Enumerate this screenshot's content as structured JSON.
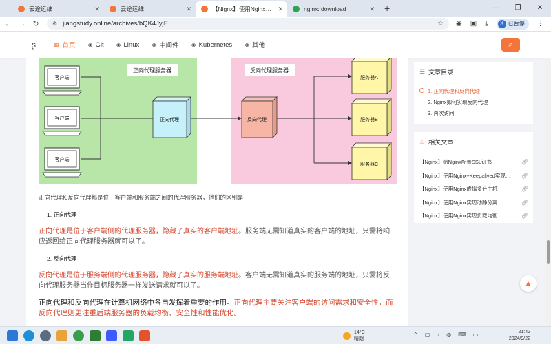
{
  "browser": {
    "tabs": [
      {
        "label": "云途运维",
        "active": false,
        "favicon_color": "#f3753c"
      },
      {
        "label": "云途运维",
        "active": false,
        "favicon_color": "#f3753c"
      },
      {
        "label": "【Nignx】使用Nginx实现反向代理",
        "active": true,
        "favicon_color": "#f3753c"
      },
      {
        "label": "nginx: download",
        "active": false,
        "favicon_color": "#2aa353"
      }
    ],
    "url": "jiangstudy.online/archives/bQK4JyjE",
    "sync_label": "已暂停",
    "avatar_letter": "X"
  },
  "site": {
    "menu": [
      {
        "label": "首页",
        "active": true
      },
      {
        "label": "Git",
        "active": false
      },
      {
        "label": "Linux",
        "active": false
      },
      {
        "label": "中间件",
        "active": false
      },
      {
        "label": "Kubernetes",
        "active": false
      },
      {
        "label": "其他",
        "active": false
      }
    ]
  },
  "diagram": {
    "forward_title": "正向代理服务器",
    "reverse_title": "反向代理服务器",
    "clients": [
      "客户端",
      "客户端",
      "客户端"
    ],
    "forward_proxy": "正向代理",
    "reverse_proxy": "反向代理",
    "servers": [
      "服务器A",
      "服务器B",
      "服务器C"
    ]
  },
  "article": {
    "intro": "正向代理和反向代理都是位于客户端和服务端之间的代理服务器，他们的区别是",
    "item1": "1. 正向代理",
    "p1_red": "正向代理是位于客户端侧的代理服务器，隐藏了真实的客户端地址",
    "p1_gray": "。服务端无需知道真实的客户端的地址，只需将响应返回给正向代理服务器就可以了。",
    "item2": "2. 反向代理",
    "p2_red": "反向代理是位于服务端侧的代理服务器，隐藏了真实的服务端地址",
    "p2_gray": "。客户端无需知道真实的服务端的地址，只需将反向代理服务器当作目标服务器一样发送请求就可以了。",
    "p3_dark": "正向代理和反向代理在计算机网络中各自发挥着重要的作用。",
    "p3_red": "正向代理主要关注客户端的访问需求和安全性，而反向代理则更注重后端服务器的负载均衡、安全性和性能优化。"
  },
  "toc": {
    "title": "文章目录",
    "items": [
      "1. 正向代理和反向代理",
      "2. Nginx如何实现反向代理",
      "3. 再次访问"
    ]
  },
  "related": {
    "title": "相关文章",
    "items": [
      "【Nginx】给Nginx配置SSL证书",
      "【Nginx】使用Nginx+Keepalived实现高可用",
      "【Nginx】使用Nginx虚拟多台主机",
      "【Nginx】使用Nginx实现动静分离",
      "【Nginx】使用Nginx实现负载均衡"
    ]
  },
  "taskbar": {
    "temp": "14°C",
    "weather": "晴朗",
    "time": "21:42",
    "date": "2024/9/22"
  }
}
